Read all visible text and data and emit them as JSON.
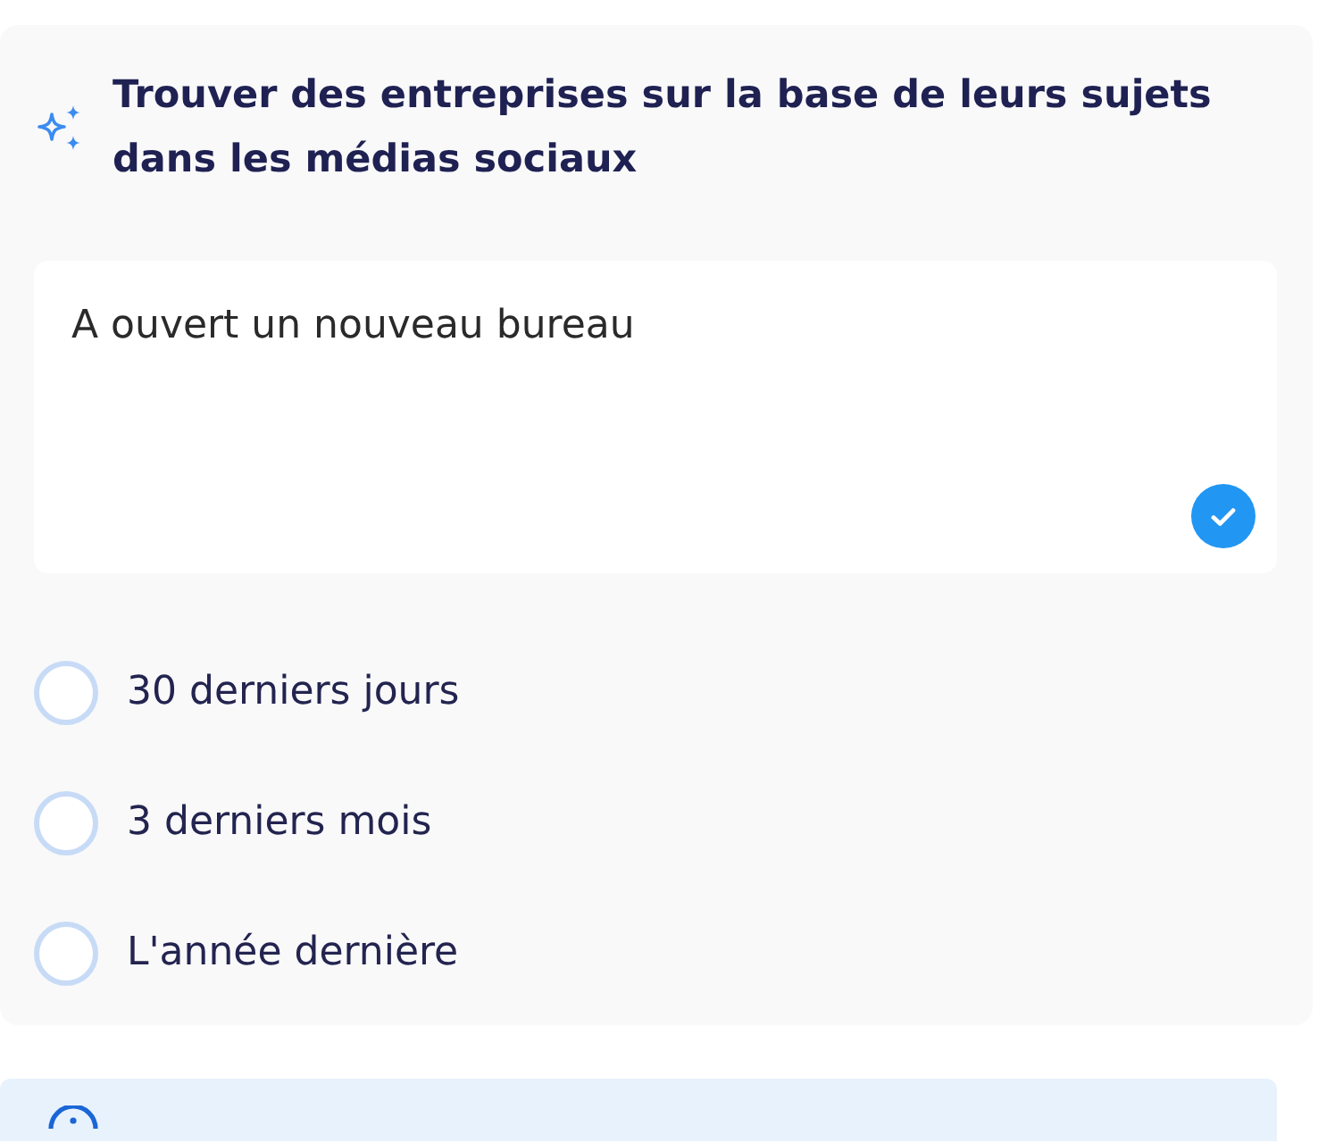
{
  "header": {
    "title": "Trouver des entreprises sur la base de leurs sujets dans les médias sociaux"
  },
  "topic_field": {
    "value": "A ouvert un nouveau bureau"
  },
  "period_options": [
    {
      "label": "30 derniers jours",
      "selected": false
    },
    {
      "label": "3 derniers mois",
      "selected": false
    },
    {
      "label": "L'année dernière",
      "selected": false
    }
  ]
}
